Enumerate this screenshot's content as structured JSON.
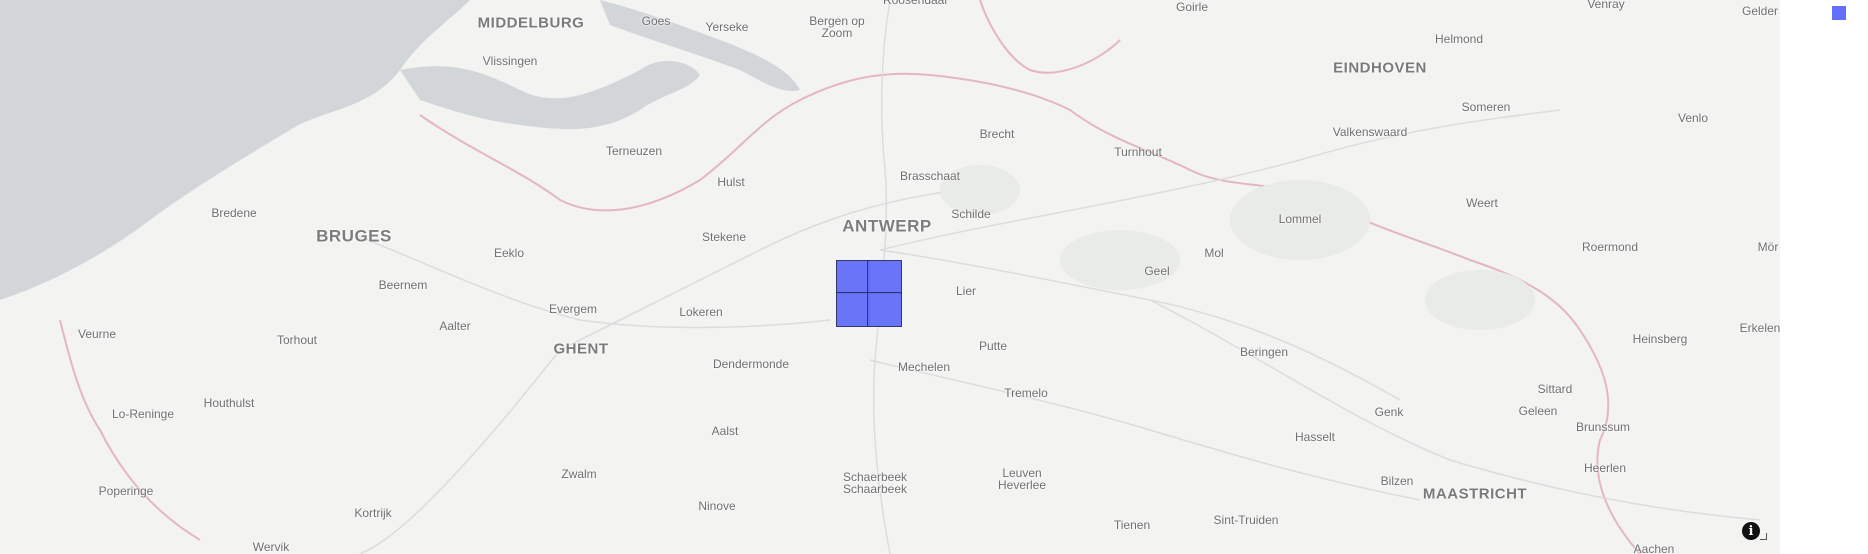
{
  "map": {
    "places": [
      {
        "name": "MIDDELBURG",
        "cls": "city",
        "key": "middelburg"
      },
      {
        "name": "Goes",
        "cls": "",
        "key": "goes"
      },
      {
        "name": "Yerseke",
        "cls": "",
        "key": "yerseke"
      },
      {
        "name": "Bergen op\nZoom",
        "cls": "",
        "key": "bergen-op-zoom"
      },
      {
        "name": "Roosendaal",
        "cls": "",
        "key": "roosendaal"
      },
      {
        "name": "Goirle",
        "cls": "",
        "key": "goirle"
      },
      {
        "name": "Venray",
        "cls": "",
        "key": "venray"
      },
      {
        "name": "Gelder",
        "cls": "",
        "key": "gelder"
      },
      {
        "name": "Helmond",
        "cls": "",
        "key": "helmond"
      },
      {
        "name": "EINDHOVEN",
        "cls": "city",
        "key": "eindhoven"
      },
      {
        "name": "Vlissingen",
        "cls": "",
        "key": "vlissingen"
      },
      {
        "name": "Someren",
        "cls": "",
        "key": "someren"
      },
      {
        "name": "Venlo",
        "cls": "",
        "key": "venlo"
      },
      {
        "name": "Valkenswaard",
        "cls": "",
        "key": "valkenswaard"
      },
      {
        "name": "Brecht",
        "cls": "",
        "key": "brecht"
      },
      {
        "name": "Terneuzen",
        "cls": "",
        "key": "terneuzen"
      },
      {
        "name": "Turnhout",
        "cls": "",
        "key": "turnhout"
      },
      {
        "name": "Brasschaat",
        "cls": "",
        "key": "brasschaat"
      },
      {
        "name": "Hulst",
        "cls": "",
        "key": "hulst"
      },
      {
        "name": "Weert",
        "cls": "",
        "key": "weert"
      },
      {
        "name": "Bredene",
        "cls": "",
        "key": "bredene"
      },
      {
        "name": "Schilde",
        "cls": "",
        "key": "schilde"
      },
      {
        "name": "Lommel",
        "cls": "",
        "key": "lommel"
      },
      {
        "name": "ANTWERP",
        "cls": "major",
        "key": "antwerp"
      },
      {
        "name": "BRUGES",
        "cls": "major",
        "key": "bruges"
      },
      {
        "name": "Stekene",
        "cls": "",
        "key": "stekene"
      },
      {
        "name": "Roermond",
        "cls": "",
        "key": "roermond"
      },
      {
        "name": "Eeklo",
        "cls": "",
        "key": "eeklo"
      },
      {
        "name": "Mol",
        "cls": "",
        "key": "mol"
      },
      {
        "name": "Mör",
        "cls": "",
        "key": "mor"
      },
      {
        "name": "Geel",
        "cls": "",
        "key": "geel"
      },
      {
        "name": "Beernem",
        "cls": "",
        "key": "beernem"
      },
      {
        "name": "Lier",
        "cls": "",
        "key": "lier"
      },
      {
        "name": "Evergem",
        "cls": "",
        "key": "evergem"
      },
      {
        "name": "Lokeren",
        "cls": "",
        "key": "lokeren"
      },
      {
        "name": "Aalter",
        "cls": "",
        "key": "aalter"
      },
      {
        "name": "Erkelen",
        "cls": "",
        "key": "erkelen"
      },
      {
        "name": "Veurne",
        "cls": "",
        "key": "veurne"
      },
      {
        "name": "Torhout",
        "cls": "",
        "key": "torhout"
      },
      {
        "name": "GHENT",
        "cls": "city",
        "key": "ghent"
      },
      {
        "name": "Heinsberg",
        "cls": "",
        "key": "heinsberg"
      },
      {
        "name": "Putte",
        "cls": "",
        "key": "putte"
      },
      {
        "name": "Beringen",
        "cls": "",
        "key": "beringen"
      },
      {
        "name": "Dendermonde",
        "cls": "",
        "key": "dendermonde"
      },
      {
        "name": "Mechelen",
        "cls": "",
        "key": "mechelen"
      },
      {
        "name": "Sittard",
        "cls": "",
        "key": "sittard"
      },
      {
        "name": "Tremelo",
        "cls": "",
        "key": "tremelo"
      },
      {
        "name": "Houthulst",
        "cls": "",
        "key": "houthulst"
      },
      {
        "name": "Genk",
        "cls": "",
        "key": "genk"
      },
      {
        "name": "Geleen",
        "cls": "",
        "key": "geleen"
      },
      {
        "name": "Lo-Reninge",
        "cls": "",
        "key": "lo-reninge"
      },
      {
        "name": "Brunssum",
        "cls": "",
        "key": "brunssum"
      },
      {
        "name": "Aalst",
        "cls": "",
        "key": "aalst"
      },
      {
        "name": "Hasselt",
        "cls": "",
        "key": "hasselt"
      },
      {
        "name": "Heerlen",
        "cls": "",
        "key": "heerlen"
      },
      {
        "name": "Zwalm",
        "cls": "",
        "key": "zwalm"
      },
      {
        "name": "Leuven\nHeverlee",
        "cls": "",
        "key": "leuven"
      },
      {
        "name": "Schaerbeek\nSchaarbeek",
        "cls": "",
        "key": "schaerbeek"
      },
      {
        "name": "Bilzen",
        "cls": "",
        "key": "bilzen"
      },
      {
        "name": "Poperinge",
        "cls": "",
        "key": "poperinge"
      },
      {
        "name": "MAASTRICHT",
        "cls": "city",
        "key": "maastricht"
      },
      {
        "name": "Ninove",
        "cls": "",
        "key": "ninove"
      },
      {
        "name": "Kortrijk",
        "cls": "",
        "key": "kortrijk"
      },
      {
        "name": "Sint-Truiden",
        "cls": "",
        "key": "sint-truiden"
      },
      {
        "name": "Tienen",
        "cls": "",
        "key": "tienen"
      },
      {
        "name": "Wervik",
        "cls": "",
        "key": "wervik"
      },
      {
        "name": "Aachen",
        "cls": "",
        "key": "aachen"
      }
    ]
  },
  "grid": {
    "fill_color": "#636efa",
    "border_color": "#2a2f66",
    "cell_count": 4
  },
  "controls": {
    "info_icon": "i",
    "info_label": "map-attribution-info"
  },
  "legend": {
    "swatch_color": "#636efa",
    "label": ""
  }
}
